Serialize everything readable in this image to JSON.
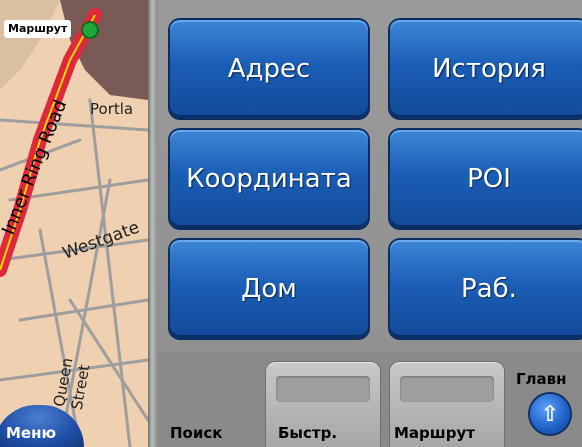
{
  "map": {
    "route_tag": "Маршрут",
    "labels": {
      "inner_ring_road": "Inner Ring Road",
      "portland": "Portla",
      "westgate": "Westgate",
      "queen_street": "Queen Street"
    },
    "menu_button": "Меню"
  },
  "search": {
    "buttons": [
      {
        "label": "Адрес"
      },
      {
        "label": "История"
      },
      {
        "label": "Координата"
      },
      {
        "label": "POI"
      },
      {
        "label": "Дом"
      },
      {
        "label": "Раб."
      }
    ]
  },
  "tabs": {
    "search_label": "Поиск",
    "quick_label": "Быстр.",
    "route_label": "Маршрут",
    "main_label": "Главн",
    "main_icon": "arrow-up-icon"
  },
  "colors": {
    "button_blue": "#1b5eb6",
    "route_red": "#e0283c",
    "map_background": "#efd0b0"
  }
}
